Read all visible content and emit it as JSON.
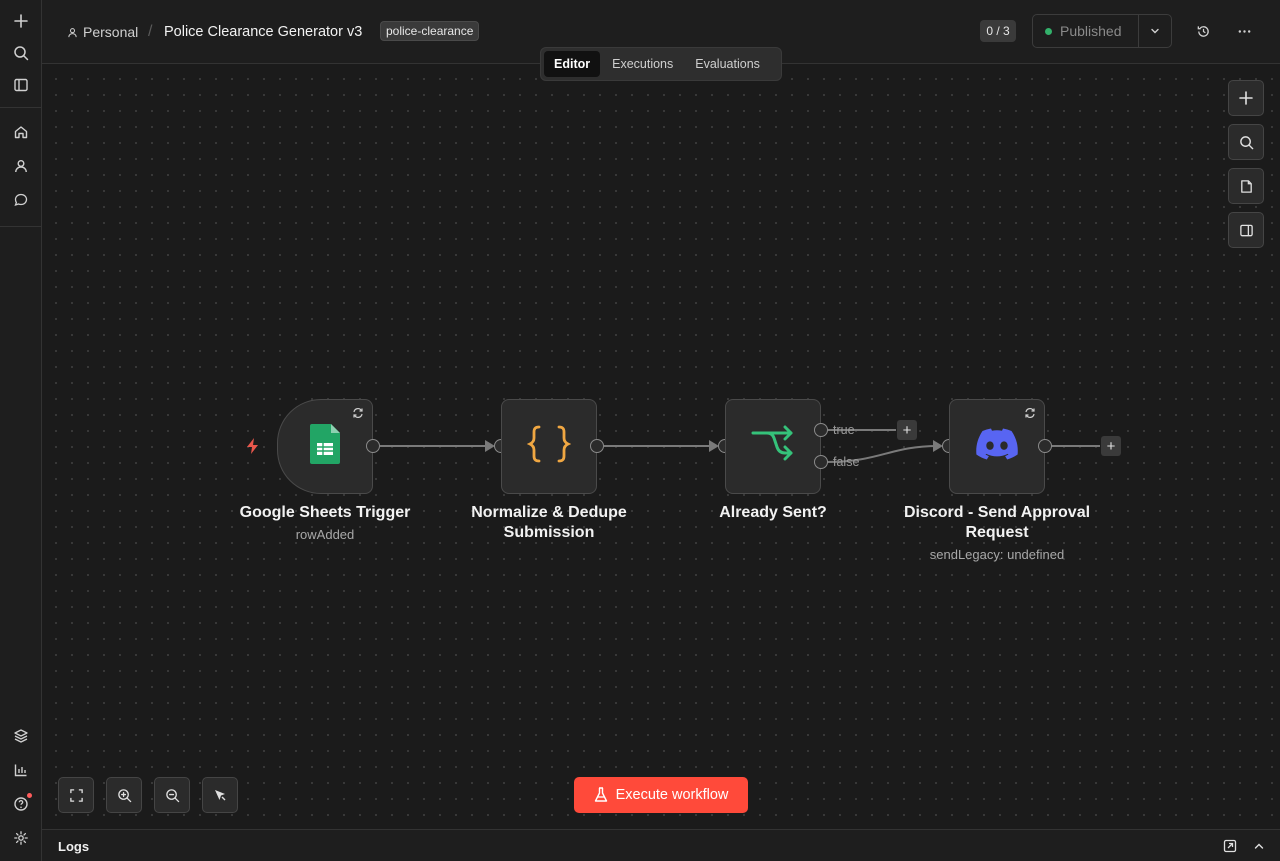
{
  "breadcrumb": {
    "workspace": "Personal",
    "separator": "/",
    "workflow_title": "Police Clearance Generator v3",
    "tag": "police-clearance"
  },
  "header": {
    "counter": "0 / 3",
    "publish_label": "Published",
    "publish_status_color": "#33b16b"
  },
  "tabs": [
    {
      "label": "Editor",
      "active": true
    },
    {
      "label": "Executions",
      "active": false
    },
    {
      "label": "Evaluations",
      "active": false
    }
  ],
  "nodes": {
    "trigger": {
      "title": "Google Sheets Trigger",
      "subtitle": "rowAdded",
      "icon": "google-sheets-icon"
    },
    "normalize": {
      "title_line1": "Normalize & Dedupe",
      "title_line2": "Submission",
      "icon": "code-braces-icon"
    },
    "if": {
      "title": "Already Sent?",
      "icon": "branch-icon",
      "true_label": "true",
      "false_label": "false"
    },
    "discord": {
      "title_line1": "Discord - Send Approval",
      "title_line2": "Request",
      "subtitle": "sendLegacy: undefined",
      "icon": "discord-icon"
    }
  },
  "execute_button": {
    "label": "Execute workflow",
    "color": "#ff4a3a"
  },
  "logs": {
    "title": "Logs"
  }
}
